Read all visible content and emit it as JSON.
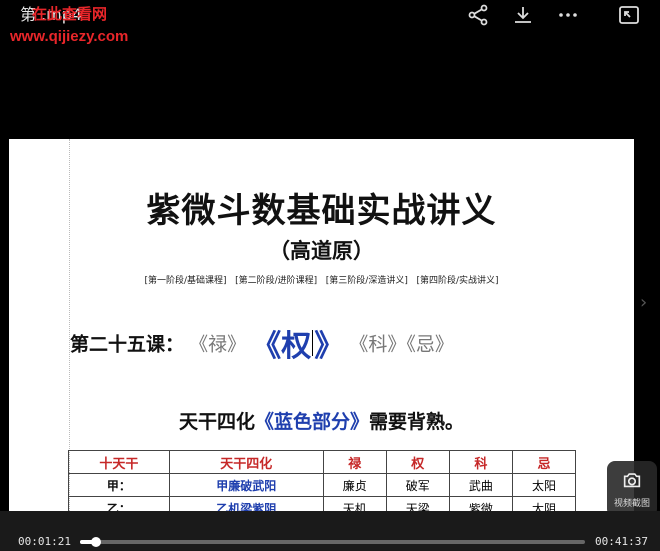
{
  "topbar": {
    "title": "第    .mp4",
    "watermark_text": "在此查看网",
    "watermark_url": "www.qijiezy.com",
    "icons": [
      "share-icon",
      "download-icon",
      "more-icon",
      "pip-icon"
    ]
  },
  "document": {
    "title": "紫微斗数基础实战讲义",
    "author": "（高道原）",
    "stages": [
      "[第一阶段/基础课程]",
      "[第二阶段/进阶课程]",
      "[第三阶段/深造讲义]",
      "[第四阶段/实战讲义]"
    ],
    "lesson_label": "第二十五课：",
    "lesson_lu": "《禄》",
    "lesson_quan_open": "《",
    "lesson_quan": "权",
    "lesson_quan_close": "》",
    "lesson_ke": "《科》",
    "lesson_ji": "《忌》",
    "memo_prefix": "天干四化",
    "memo_blue": "《蓝色部分》",
    "memo_suffix": "需要背熟。",
    "table": {
      "headers": [
        "十天干",
        "天干四化",
        "禄",
        "权",
        "科",
        "忌"
      ],
      "rows": [
        [
          "甲：",
          "甲廉破武阳",
          "廉贞",
          "破军",
          "武曲",
          "太阳"
        ],
        [
          "乙：",
          "乙机梁紫阴",
          "天机",
          "天梁",
          "紫微",
          "太阴"
        ]
      ]
    }
  },
  "snapshot": {
    "label": "视频截图"
  },
  "player": {
    "current_time": "00:01:21",
    "total_time": "00:41:37",
    "progress_percent": 3.2
  }
}
